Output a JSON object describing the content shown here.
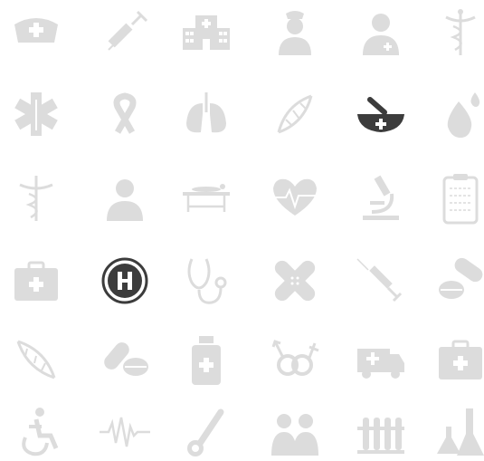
{
  "icons": [
    {
      "name": "nurse-cap-icon",
      "shade": "muted"
    },
    {
      "name": "syringe-icon",
      "shade": "muted"
    },
    {
      "name": "hospital-building-icon",
      "shade": "muted"
    },
    {
      "name": "nurse-icon",
      "shade": "muted"
    },
    {
      "name": "doctor-icon",
      "shade": "muted"
    },
    {
      "name": "caduceus-icon",
      "shade": "muted"
    },
    {
      "name": "star-of-life-icon",
      "shade": "muted"
    },
    {
      "name": "awareness-ribbon-icon",
      "shade": "muted"
    },
    {
      "name": "lungs-icon",
      "shade": "muted"
    },
    {
      "name": "dna-icon",
      "shade": "muted"
    },
    {
      "name": "mortar-pestle-icon",
      "shade": "dark"
    },
    {
      "name": "blood-drop-icon",
      "shade": "muted"
    },
    {
      "name": "caduceus-icon",
      "shade": "muted"
    },
    {
      "name": "patient-icon",
      "shade": "muted"
    },
    {
      "name": "stretcher-icon",
      "shade": "muted"
    },
    {
      "name": "heartbeat-icon",
      "shade": "muted"
    },
    {
      "name": "microscope-icon",
      "shade": "muted"
    },
    {
      "name": "clipboard-icon",
      "shade": "muted"
    },
    {
      "name": "first-aid-kit-icon",
      "shade": "muted"
    },
    {
      "name": "hospital-sign-icon",
      "shade": "dark"
    },
    {
      "name": "stethoscope-icon",
      "shade": "muted"
    },
    {
      "name": "bandage-icon",
      "shade": "muted"
    },
    {
      "name": "syringe-icon",
      "shade": "muted"
    },
    {
      "name": "pills-icon",
      "shade": "muted"
    },
    {
      "name": "dna-icon",
      "shade": "muted"
    },
    {
      "name": "pills-icon",
      "shade": "muted"
    },
    {
      "name": "medicine-bottle-icon",
      "shade": "muted"
    },
    {
      "name": "gender-symbols-icon",
      "shade": "muted"
    },
    {
      "name": "ambulance-icon",
      "shade": "muted"
    },
    {
      "name": "first-aid-kit-icon",
      "shade": "muted"
    },
    {
      "name": "wheelchair-icon",
      "shade": "muted"
    },
    {
      "name": "pulse-line-icon",
      "shade": "muted"
    },
    {
      "name": "thermometer-icon",
      "shade": "muted"
    },
    {
      "name": "people-icon",
      "shade": "muted"
    },
    {
      "name": "test-tubes-icon",
      "shade": "muted"
    },
    {
      "name": "lab-flasks-icon",
      "shade": "muted"
    }
  ],
  "colors": {
    "muted": "#dcdcdc",
    "dark": "#3c3c3c",
    "background": "#ffffff"
  }
}
